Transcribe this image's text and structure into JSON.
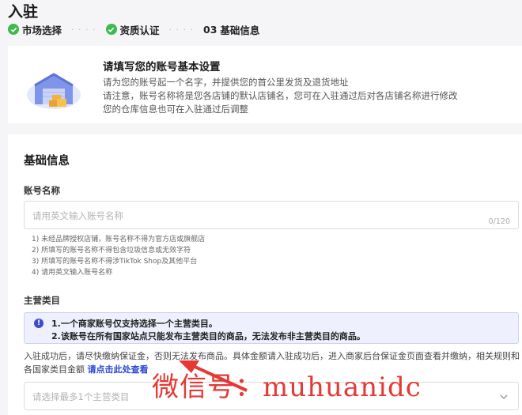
{
  "page": {
    "title": "入驻"
  },
  "steps": [
    {
      "label": "市场选择",
      "status": "done"
    },
    {
      "label": "资质认证",
      "status": "done"
    },
    {
      "num": "03",
      "label": "基础信息",
      "status": "current"
    }
  ],
  "intro": {
    "title": "请填写您的账号基本设置",
    "lines": [
      "请为您的账号起一个名字，并提供您的首公里发货及退货地址",
      "请注意，账号名称将是您各店铺的默认店铺名，您可在入驻通过后对各店铺名称进行修改",
      "您的仓库信息也可在入驻通过后调整"
    ]
  },
  "form": {
    "section_title": "基础信息",
    "account": {
      "label": "账号名称",
      "placeholder": "请用英文输入账号名称",
      "counter": "0/120",
      "hints": [
        "1) 未经品牌授权店铺，账号名称不得为官方店或旗舰店",
        "2) 所填写的账号名称不得包含垃圾信息或无效字符",
        "3) 所填写的账号名称不得涉TikTok Shop及其他平台",
        "4) 请用英文输入账号名称"
      ]
    },
    "category": {
      "label": "主营类目",
      "notice": [
        "1.一个商家账号仅支持选择一个主营类目。",
        "2.该账号在所有国家站点只能发布主营类目的商品，无法发布非主营类目的商品。"
      ],
      "desc": "入驻成功后，请尽快缴纳保证金，否则无法发布商品。具体金额请入驻成功后，进入商家后台保证金页面查看并缴纳，相关规则和各国家类目金额",
      "link": "请点击此处查看",
      "placeholder": "请选择最多1个主营类目"
    }
  },
  "watermark": "微信号：muhuanidc",
  "colors": {
    "accent": "#2b46d6",
    "success": "#3fb950",
    "watermark": "#e53935"
  }
}
